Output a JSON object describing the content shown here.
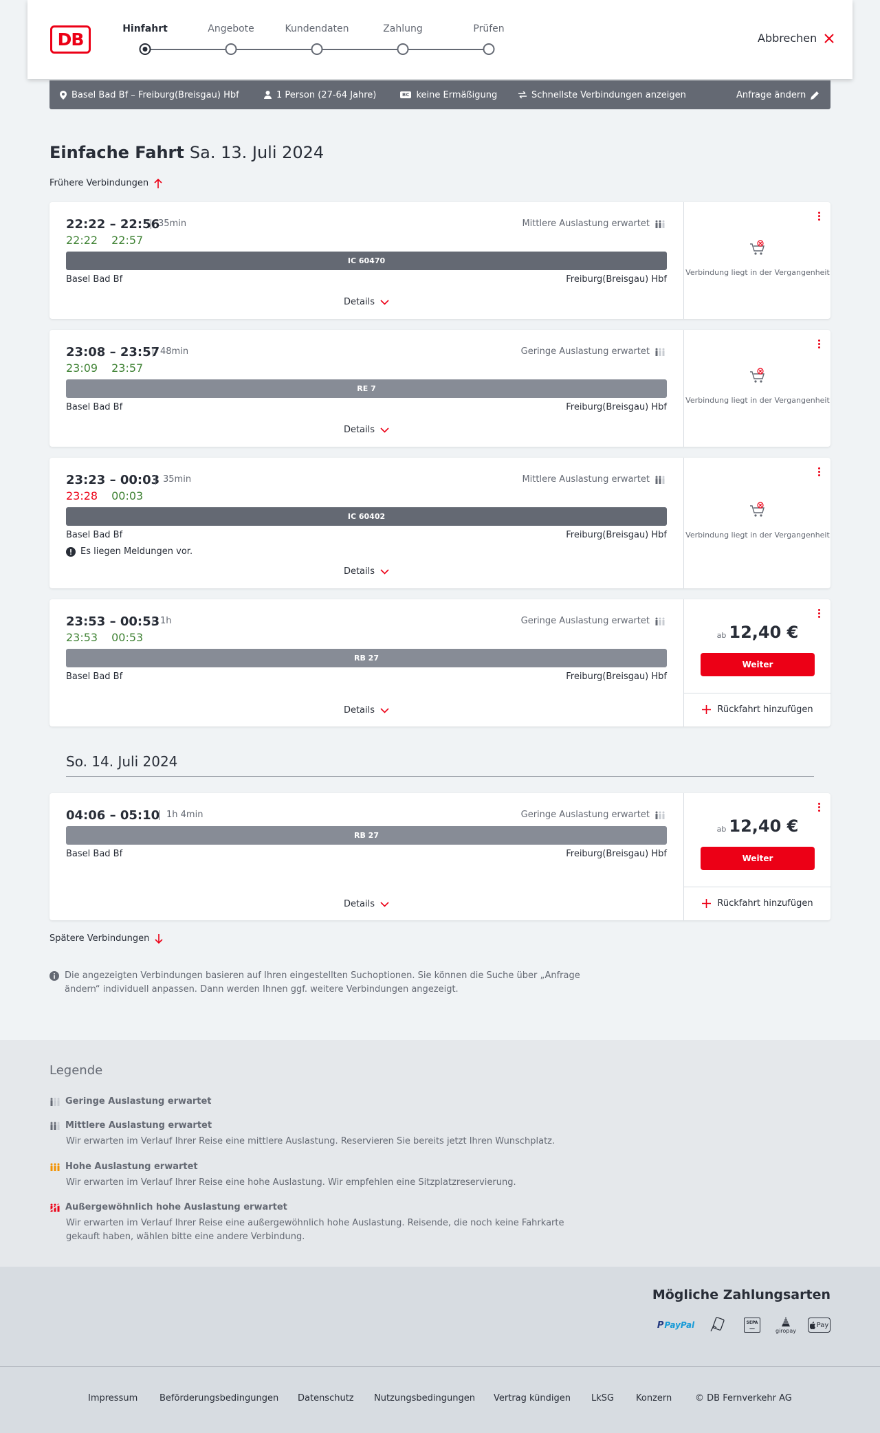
{
  "header": {
    "logo_text": "DB",
    "steps": [
      {
        "label": "Hinfahrt",
        "active": true
      },
      {
        "label": "Angebote",
        "active": false
      },
      {
        "label": "Kundendaten",
        "active": false
      },
      {
        "label": "Zahlung",
        "active": false
      },
      {
        "label": "Prüfen",
        "active": false
      }
    ],
    "cancel_label": "Abbrechen"
  },
  "query": {
    "route": "Basel Bad Bf – Freiburg(Breisgau) Hbf",
    "travelers": "1 Person (27-64 Jahre)",
    "bc_badge": "BC",
    "discount": "keine Ermäßigung",
    "option": "Schnellste Verbindungen anzeigen",
    "change_label": "Anfrage ändern"
  },
  "page": {
    "title_bold": "Einfache Fahrt",
    "date": "Sa. 13. Juli 2024",
    "earlier": "Frühere Verbindungen",
    "later": "Spätere Verbindungen",
    "day2": "So. 14. Juli 2024",
    "info": "Die angezeigten Verbindungen basieren auf Ihren eingestellten Suchoptionen. Sie können die Suche über „Anfrage ändern“ individuell anpassen. Dann werden Ihnen ggf. weitere Verbindungen angezeigt."
  },
  "connections": [
    {
      "times": "22:22 – 22:56",
      "duration": "35min",
      "rt_dep": "22:22",
      "rt_arr": "22:57",
      "rt_dep_late": false,
      "load": "Mittlere Auslastung erwartet",
      "train": "IC 60470",
      "train_style": "dark",
      "from": "Basel Bad Bf",
      "to": "Freiburg(Breisgau) Hbf",
      "details": "Details",
      "status": "Verbindung liegt in der Vergangenheit"
    },
    {
      "times": "23:08 – 23:57",
      "duration": "48min",
      "rt_dep": "23:09",
      "rt_arr": "23:57",
      "rt_dep_late": false,
      "load": "Geringe Auslastung erwartet",
      "train": "RE 7",
      "train_style": "light",
      "from": "Basel Bad Bf",
      "to": "Freiburg(Breisgau) Hbf",
      "details": "Details",
      "status": "Verbindung liegt in der Vergangenheit"
    },
    {
      "times": "23:23 – 00:03",
      "duration": "35min",
      "rt_dep": "23:28",
      "rt_arr": "00:03",
      "rt_dep_late": true,
      "load": "Mittlere Auslastung erwartet",
      "train": "IC 60402",
      "train_style": "dark",
      "from": "Basel Bad Bf",
      "to": "Freiburg(Breisgau) Hbf",
      "message": "Es liegen Meldungen vor.",
      "details": "Details",
      "status": "Verbindung liegt in der Vergangenheit"
    },
    {
      "times": "23:53 – 00:53",
      "duration": "1h",
      "rt_dep": "23:53",
      "rt_arr": "00:53",
      "rt_dep_late": false,
      "load": "Geringe Auslastung erwartet",
      "train": "RB 27",
      "train_style": "light",
      "from": "Basel Bad Bf",
      "to": "Freiburg(Breisgau) Hbf",
      "details": "Details",
      "price_prefix": "ab",
      "price": "12,40 €",
      "button": "Weiter",
      "return": "Rückfahrt hinzufügen"
    },
    {
      "times": "04:06 – 05:10",
      "duration": "1h 4min",
      "load": "Geringe Auslastung erwartet",
      "train": "RB 27",
      "train_style": "light",
      "from": "Basel Bad Bf",
      "to": "Freiburg(Breisgau) Hbf",
      "details": "Details",
      "price_prefix": "ab",
      "price": "12,40 €",
      "button": "Weiter",
      "return": "Rückfahrt hinzufügen"
    }
  ],
  "legend": {
    "title": "Legende",
    "items": [
      {
        "title": "Geringe Auslastung erwartet",
        "desc": ""
      },
      {
        "title": "Mittlere Auslastung erwartet",
        "desc": "Wir erwarten im Verlauf Ihrer Reise eine mittlere Auslastung. Reservieren Sie bereits jetzt Ihren Wunschplatz."
      },
      {
        "title": "Hohe Auslastung erwartet",
        "desc": "Wir erwarten im Verlauf Ihrer Reise eine hohe Auslastung. Wir empfehlen eine Sitzplatzreservierung."
      },
      {
        "title": "Außergewöhnlich hohe Auslastung erwartet",
        "desc": "Wir erwarten im Verlauf Ihrer Reise eine außergewöhnlich hohe Auslastung. Reisende, die noch keine Fahrkarte gekauft haben, wählen bitte eine andere Verbindung."
      }
    ],
    "colors": {
      "low": "#646973",
      "mid": "#646973",
      "high": "#f39200",
      "extreme": "#ec0016"
    }
  },
  "payment": {
    "title": "Mögliche Zahlungsarten",
    "methods": [
      "PayPal",
      "SEPA",
      "giropay",
      "Pay"
    ]
  },
  "footer": {
    "links": [
      "Impressum",
      "Beförderungsbedingungen",
      "Datenschutz",
      "Nutzungsbedingungen",
      "Vertrag kündigen",
      "LkSG",
      "Konzern",
      "© DB Fernverkehr AG"
    ]
  },
  "colors": {
    "accent": "#ec0016",
    "on_time": "#408335",
    "bar_dark": "#646973",
    "bar_light": "#878c96"
  }
}
